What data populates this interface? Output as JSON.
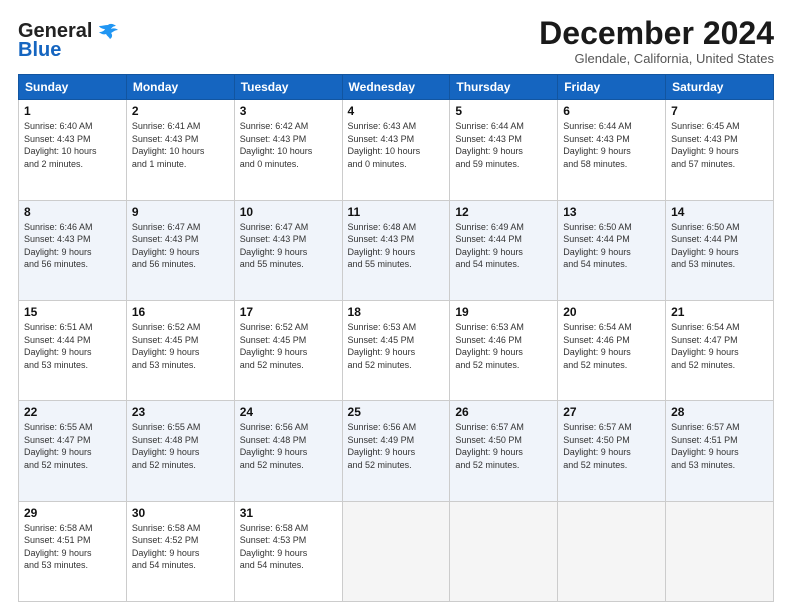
{
  "header": {
    "logo_general": "General",
    "logo_blue": "Blue",
    "month_title": "December 2024",
    "location": "Glendale, California, United States"
  },
  "days_of_week": [
    "Sunday",
    "Monday",
    "Tuesday",
    "Wednesday",
    "Thursday",
    "Friday",
    "Saturday"
  ],
  "weeks": [
    [
      {
        "day": "1",
        "info": "Sunrise: 6:40 AM\nSunset: 4:43 PM\nDaylight: 10 hours\nand 2 minutes."
      },
      {
        "day": "2",
        "info": "Sunrise: 6:41 AM\nSunset: 4:43 PM\nDaylight: 10 hours\nand 1 minute."
      },
      {
        "day": "3",
        "info": "Sunrise: 6:42 AM\nSunset: 4:43 PM\nDaylight: 10 hours\nand 0 minutes."
      },
      {
        "day": "4",
        "info": "Sunrise: 6:43 AM\nSunset: 4:43 PM\nDaylight: 10 hours\nand 0 minutes."
      },
      {
        "day": "5",
        "info": "Sunrise: 6:44 AM\nSunset: 4:43 PM\nDaylight: 9 hours\nand 59 minutes."
      },
      {
        "day": "6",
        "info": "Sunrise: 6:44 AM\nSunset: 4:43 PM\nDaylight: 9 hours\nand 58 minutes."
      },
      {
        "day": "7",
        "info": "Sunrise: 6:45 AM\nSunset: 4:43 PM\nDaylight: 9 hours\nand 57 minutes."
      }
    ],
    [
      {
        "day": "8",
        "info": "Sunrise: 6:46 AM\nSunset: 4:43 PM\nDaylight: 9 hours\nand 56 minutes."
      },
      {
        "day": "9",
        "info": "Sunrise: 6:47 AM\nSunset: 4:43 PM\nDaylight: 9 hours\nand 56 minutes."
      },
      {
        "day": "10",
        "info": "Sunrise: 6:47 AM\nSunset: 4:43 PM\nDaylight: 9 hours\nand 55 minutes."
      },
      {
        "day": "11",
        "info": "Sunrise: 6:48 AM\nSunset: 4:43 PM\nDaylight: 9 hours\nand 55 minutes."
      },
      {
        "day": "12",
        "info": "Sunrise: 6:49 AM\nSunset: 4:44 PM\nDaylight: 9 hours\nand 54 minutes."
      },
      {
        "day": "13",
        "info": "Sunrise: 6:50 AM\nSunset: 4:44 PM\nDaylight: 9 hours\nand 54 minutes."
      },
      {
        "day": "14",
        "info": "Sunrise: 6:50 AM\nSunset: 4:44 PM\nDaylight: 9 hours\nand 53 minutes."
      }
    ],
    [
      {
        "day": "15",
        "info": "Sunrise: 6:51 AM\nSunset: 4:44 PM\nDaylight: 9 hours\nand 53 minutes."
      },
      {
        "day": "16",
        "info": "Sunrise: 6:52 AM\nSunset: 4:45 PM\nDaylight: 9 hours\nand 53 minutes."
      },
      {
        "day": "17",
        "info": "Sunrise: 6:52 AM\nSunset: 4:45 PM\nDaylight: 9 hours\nand 52 minutes."
      },
      {
        "day": "18",
        "info": "Sunrise: 6:53 AM\nSunset: 4:45 PM\nDaylight: 9 hours\nand 52 minutes."
      },
      {
        "day": "19",
        "info": "Sunrise: 6:53 AM\nSunset: 4:46 PM\nDaylight: 9 hours\nand 52 minutes."
      },
      {
        "day": "20",
        "info": "Sunrise: 6:54 AM\nSunset: 4:46 PM\nDaylight: 9 hours\nand 52 minutes."
      },
      {
        "day": "21",
        "info": "Sunrise: 6:54 AM\nSunset: 4:47 PM\nDaylight: 9 hours\nand 52 minutes."
      }
    ],
    [
      {
        "day": "22",
        "info": "Sunrise: 6:55 AM\nSunset: 4:47 PM\nDaylight: 9 hours\nand 52 minutes."
      },
      {
        "day": "23",
        "info": "Sunrise: 6:55 AM\nSunset: 4:48 PM\nDaylight: 9 hours\nand 52 minutes."
      },
      {
        "day": "24",
        "info": "Sunrise: 6:56 AM\nSunset: 4:48 PM\nDaylight: 9 hours\nand 52 minutes."
      },
      {
        "day": "25",
        "info": "Sunrise: 6:56 AM\nSunset: 4:49 PM\nDaylight: 9 hours\nand 52 minutes."
      },
      {
        "day": "26",
        "info": "Sunrise: 6:57 AM\nSunset: 4:50 PM\nDaylight: 9 hours\nand 52 minutes."
      },
      {
        "day": "27",
        "info": "Sunrise: 6:57 AM\nSunset: 4:50 PM\nDaylight: 9 hours\nand 52 minutes."
      },
      {
        "day": "28",
        "info": "Sunrise: 6:57 AM\nSunset: 4:51 PM\nDaylight: 9 hours\nand 53 minutes."
      }
    ],
    [
      {
        "day": "29",
        "info": "Sunrise: 6:58 AM\nSunset: 4:51 PM\nDaylight: 9 hours\nand 53 minutes."
      },
      {
        "day": "30",
        "info": "Sunrise: 6:58 AM\nSunset: 4:52 PM\nDaylight: 9 hours\nand 54 minutes."
      },
      {
        "day": "31",
        "info": "Sunrise: 6:58 AM\nSunset: 4:53 PM\nDaylight: 9 hours\nand 54 minutes."
      },
      {
        "day": "",
        "info": ""
      },
      {
        "day": "",
        "info": ""
      },
      {
        "day": "",
        "info": ""
      },
      {
        "day": "",
        "info": ""
      }
    ]
  ]
}
